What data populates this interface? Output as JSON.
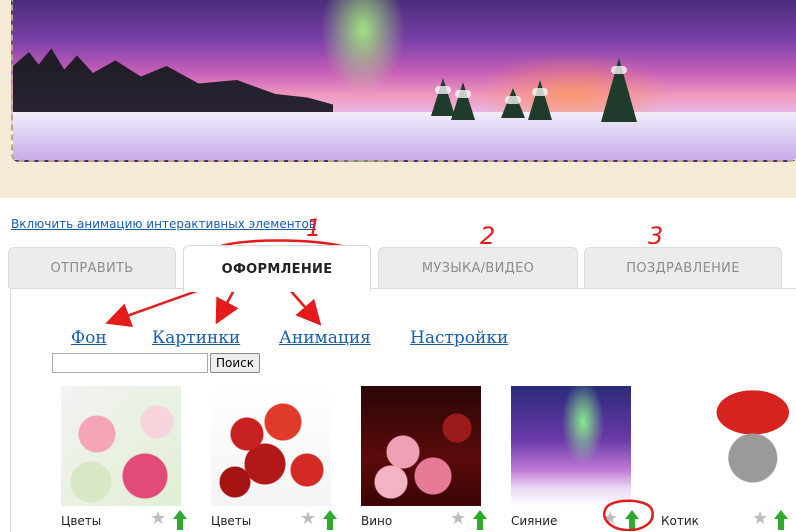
{
  "header": {
    "banner_alt": "aurora-winter-banner"
  },
  "animation_toggle": {
    "label": "Включить анимацию интерактивных элементов"
  },
  "tabs": [
    {
      "label": "ОТПРАВИТЬ"
    },
    {
      "label": "ОФОРМЛЕНИЕ"
    },
    {
      "label": "МУЗЫКА/ВИДЕО"
    },
    {
      "label": "ПОЗДРАВЛЕНИЕ"
    }
  ],
  "subnav": [
    {
      "label": "Фон"
    },
    {
      "label": "Картинки"
    },
    {
      "label": "Анимация"
    },
    {
      "label": "Настройки"
    }
  ],
  "search": {
    "placeholder": "",
    "value": "",
    "button_label": "Поиск"
  },
  "gallery": [
    {
      "label": "Цветы"
    },
    {
      "label": "Цветы"
    },
    {
      "label": "Вино"
    },
    {
      "label": "Сияние"
    },
    {
      "label": "Котик"
    }
  ],
  "annotations": {
    "numbers": [
      "1",
      "2",
      "3"
    ],
    "color": "#e31b1b",
    "highlight_color": "#e31b1b"
  },
  "colors": {
    "link": "#1a5dad",
    "tab_bg": "#ececec",
    "frame_bg": "#f4ead6",
    "upvote_green": "#2faa2f"
  }
}
